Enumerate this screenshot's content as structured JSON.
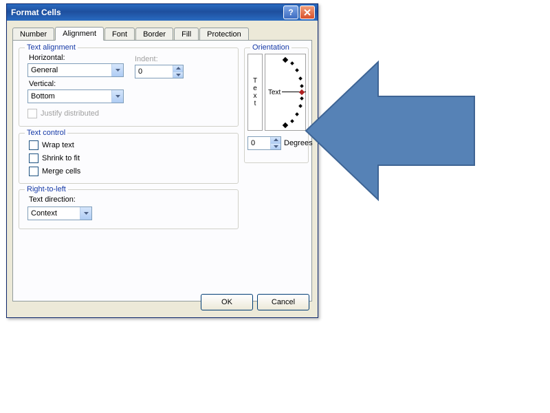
{
  "title": "Format Cells",
  "tabs": [
    "Number",
    "Alignment",
    "Font",
    "Border",
    "Fill",
    "Protection"
  ],
  "active_tab": 1,
  "text_alignment": {
    "group": "Text alignment",
    "horizontal_label": "Horizontal:",
    "horizontal_value": "General",
    "vertical_label": "Vertical:",
    "vertical_value": "Bottom",
    "indent_label": "Indent:",
    "indent_value": "0",
    "justify_label": "Justify distributed"
  },
  "text_control": {
    "group": "Text control",
    "wrap": "Wrap text",
    "shrink": "Shrink to fit",
    "merge": "Merge cells"
  },
  "rtl": {
    "group": "Right-to-left",
    "direction_label": "Text direction:",
    "direction_value": "Context"
  },
  "orientation": {
    "group": "Orientation",
    "vertical_text": "Text",
    "dial_text": "Text",
    "degrees_label": "Degrees",
    "degrees_value": "0"
  },
  "buttons": {
    "ok": "OK",
    "cancel": "Cancel"
  }
}
